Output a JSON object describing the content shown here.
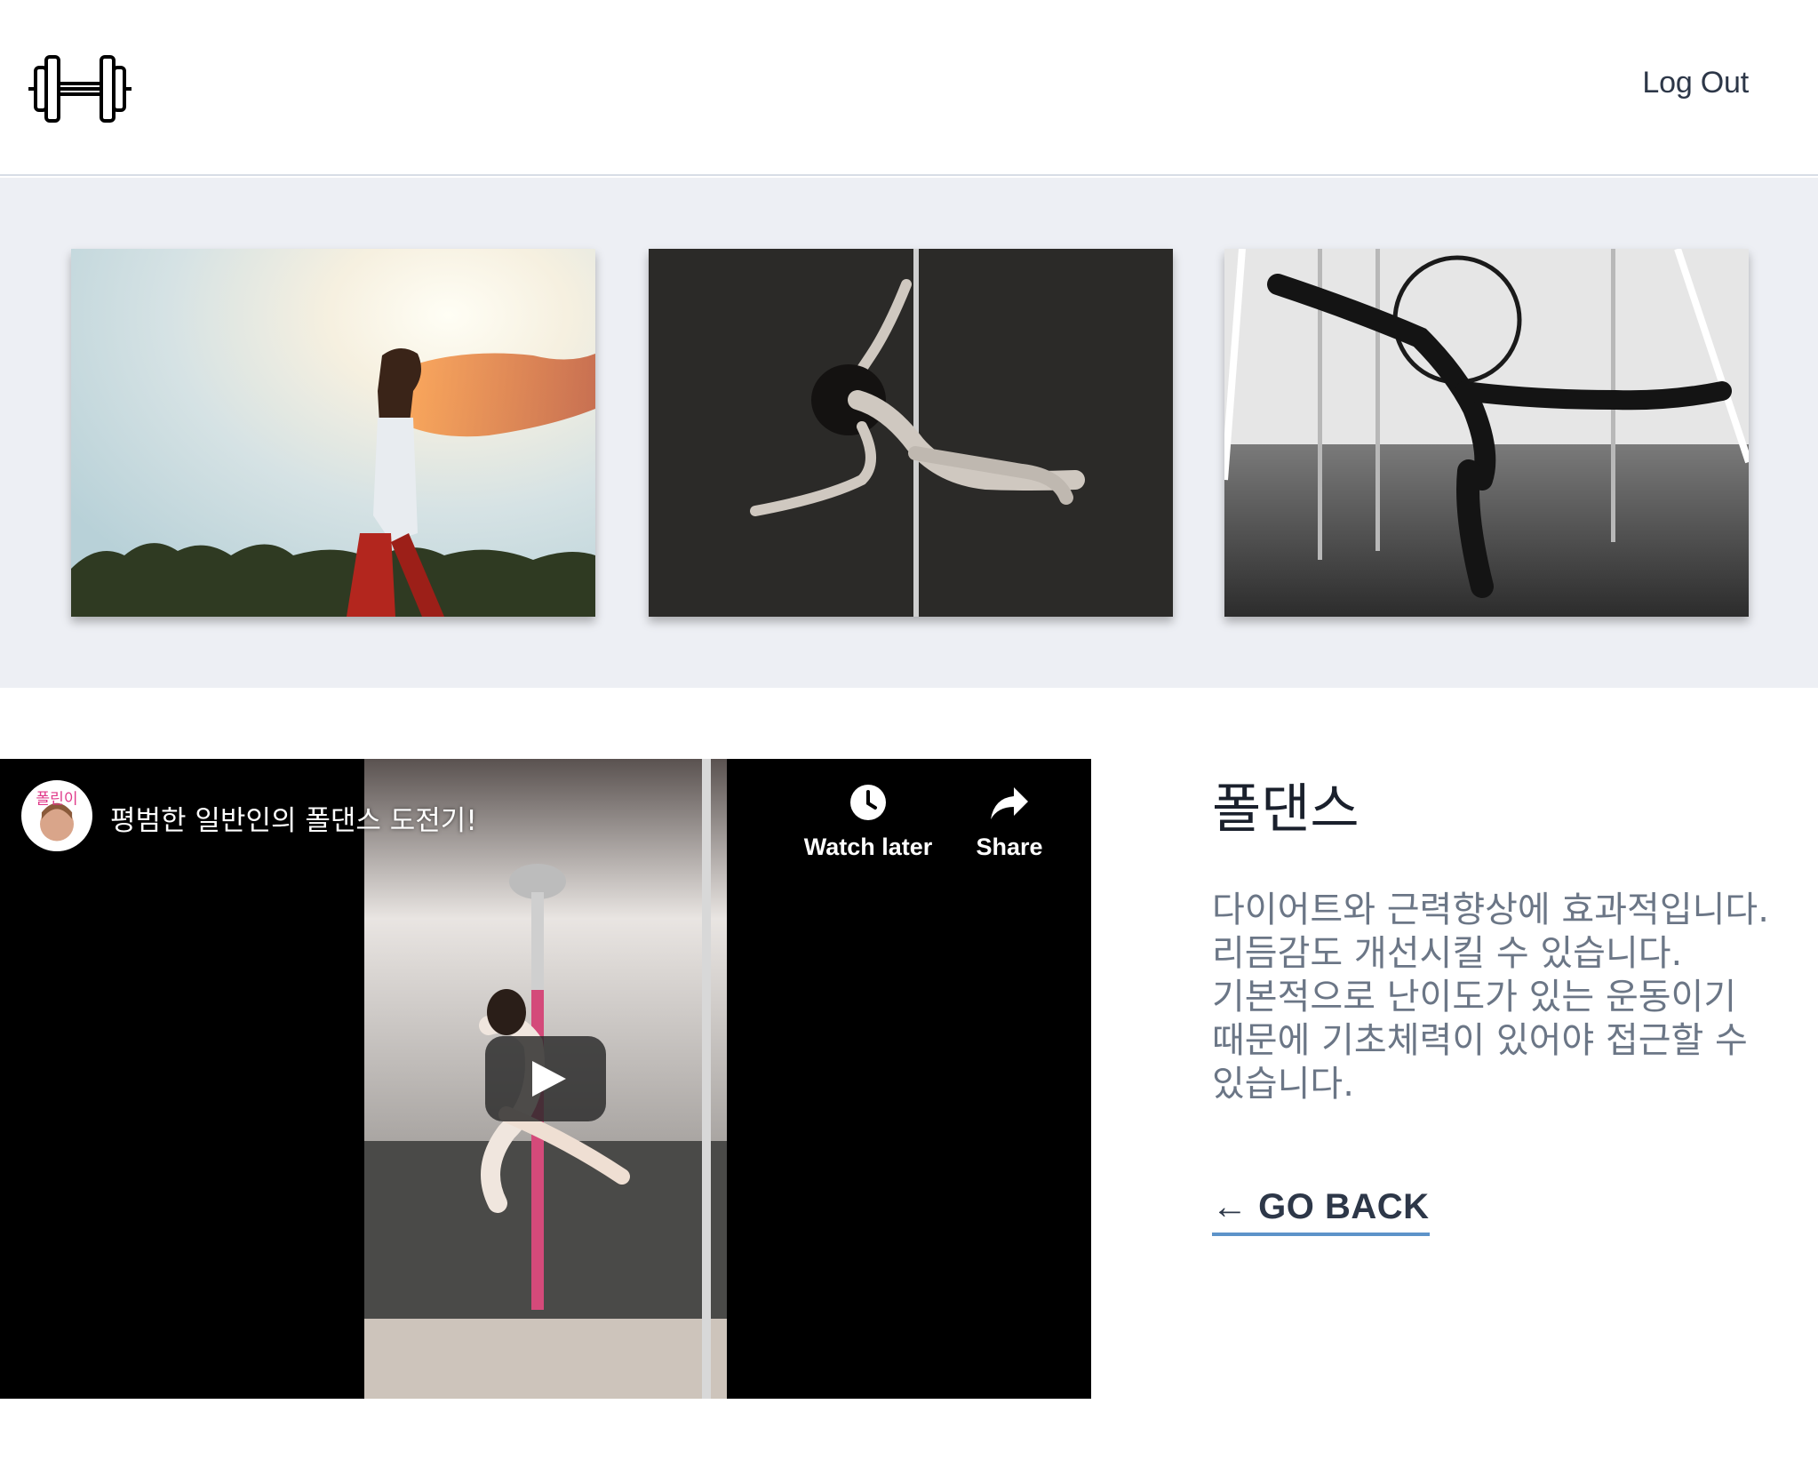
{
  "header": {
    "logo_icon": "dumbbell-icon",
    "logout_label": "Log Out"
  },
  "gallery": {
    "images": [
      {
        "subject": "woman-with-scarf-at-sunset"
      },
      {
        "subject": "pole-dancer-black-and-white"
      },
      {
        "subject": "aerial-dancer-studio"
      }
    ]
  },
  "video": {
    "title": "평범한 일반인의 폴댄스 도전기!",
    "channel_avatar_text": "폴린이",
    "watch_later_label": "Watch later",
    "share_label": "Share",
    "icons": {
      "watch_later": "clock-icon",
      "share": "share-arrow-icon",
      "play": "play-icon"
    }
  },
  "content": {
    "title": "폴댄스",
    "description_lines": [
      "다이어트와 근력향상에 효과적입니다.",
      "리듬감도 개선시킬 수 있습니다.",
      "기본적으로 난이도가 있는 운동이기",
      "때문에 기초체력이 있어야 접근할 수",
      "있습니다."
    ],
    "go_back_label": "← GO BACK"
  },
  "colors": {
    "gallery_bg": "#edeff4",
    "link_underline": "#5d93c9",
    "text_dark": "#2d3748",
    "text_muted": "#6b7686"
  }
}
